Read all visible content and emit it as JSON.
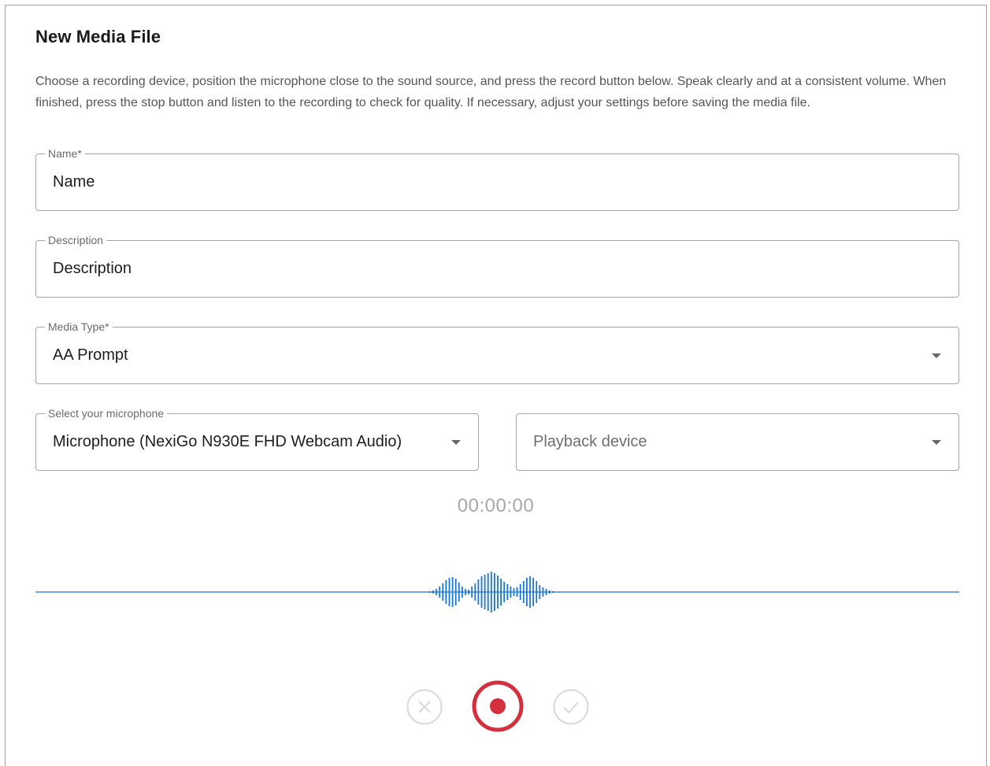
{
  "form": {
    "title": "New Media File",
    "instructions": "Choose a recording device, position the microphone close to the sound source, and press the record button below. Speak clearly and at a consistent volume. When finished, press the stop button and listen to the recording to check for quality. If necessary, adjust your settings before saving the media file."
  },
  "fields": {
    "name": {
      "label": "Name*",
      "value": "Name"
    },
    "description": {
      "label": "Description",
      "value": "Description"
    },
    "media_type": {
      "label": "Media Type*",
      "value": "AA Prompt"
    },
    "microphone": {
      "label": "Select your microphone",
      "value": "Microphone (NexiGo N930E FHD Webcam Audio)"
    },
    "playback": {
      "placeholder": "Playback device"
    }
  },
  "recorder": {
    "timer": "00:00:00",
    "accent_color": "#1976d2",
    "record_color": "#d32f3c",
    "disabled_color": "#d6d6d6",
    "icons": {
      "discard": "close-circle-icon",
      "record": "record-icon",
      "save": "check-circle-icon"
    }
  }
}
